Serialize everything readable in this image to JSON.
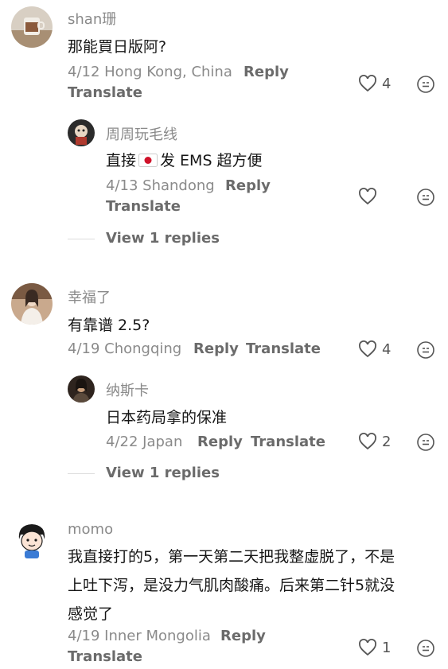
{
  "comments": [
    {
      "user": "shan珊",
      "text": "那能買日版阿?",
      "meta": "4/12 Hong Kong, China",
      "reply_label": "Reply",
      "translate_label": "Translate",
      "likes": "4"
    },
    {
      "user": "周周玩毛线",
      "text_before_flag": "直接",
      "flag_icon": "japan-flag",
      "text_after_flag": "发 EMS 超方便",
      "meta": "4/13 Shandong",
      "reply_label": "Reply",
      "translate_label": "Translate",
      "likes": ""
    },
    {
      "view_replies": "View 1 replies"
    },
    {
      "user": "幸福了",
      "text": "有靠谱 2.5?",
      "meta": "4/19 Chongqing",
      "reply_label": "Reply",
      "translate_label": "Translate",
      "likes": "4"
    },
    {
      "user": "纳斯卡",
      "text": "日本药局拿的保准",
      "meta": "4/22 Japan",
      "reply_label": "Reply",
      "translate_label": "Translate",
      "likes": "2"
    },
    {
      "view_replies": "View 1 replies"
    },
    {
      "user": "momo",
      "text_lines": [
        "我直接打的5，第一天第二天把我整虚脱了，不是",
        "上吐下泻，是没力气肌肉酸痛。后来第二针5就没",
        "感觉了"
      ],
      "meta": "4/19 Inner Mongolia",
      "reply_label": "Reply",
      "translate_label": "Translate",
      "likes": "1"
    }
  ],
  "colors": {
    "text": "#161616",
    "meta": "#8a8a8a",
    "action": "#6b6b6b",
    "icon": "#555555"
  }
}
